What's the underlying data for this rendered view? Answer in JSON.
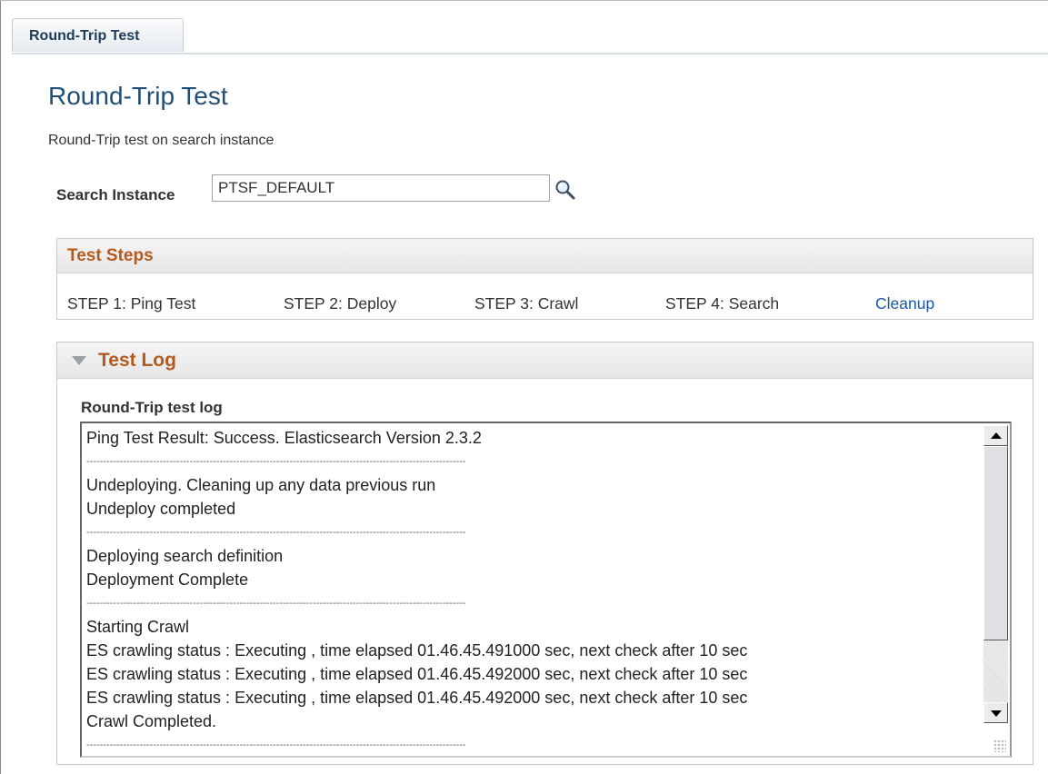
{
  "tabs": [
    {
      "label": "Round-Trip Test"
    }
  ],
  "page": {
    "title": "Round-Trip Test",
    "description": "Round-Trip test on search instance"
  },
  "search_instance": {
    "label": "Search Instance",
    "value": "PTSF_DEFAULT",
    "lookup_icon": "magnifier-lookup-icon"
  },
  "test_steps": {
    "title": "Test Steps",
    "steps": [
      "STEP 1: Ping Test",
      "STEP 2: Deploy",
      "STEP 3: Crawl",
      "STEP 4: Search"
    ],
    "cleanup_label": "Cleanup"
  },
  "test_log": {
    "title": "Test Log",
    "collapse_icon": "triangle-down-icon",
    "field_label": "Round-Trip test log",
    "separator": "------------------------------------------------------------------------------------------------------------------",
    "lines": [
      "Ping Test Result: Success. Elasticsearch Version 2.3.2",
      "---",
      "Undeploying. Cleaning up any data previous run",
      "Undeploy completed",
      "---",
      "Deploying search definition",
      "Deployment Complete",
      "---",
      "Starting Crawl",
      "ES crawling status : Executing , time elapsed 01.46.45.491000 sec, next check after 10 sec",
      "ES crawling status : Executing , time elapsed 01.46.45.492000 sec, next check after 10 sec",
      "ES crawling status : Executing , time elapsed 01.46.45.492000 sec, next check after 10 sec",
      "Crawl Completed.",
      "---"
    ]
  },
  "colors": {
    "title": "#1f4e79",
    "group_header_text": "#b45a1e",
    "link": "#1a5aa3"
  }
}
